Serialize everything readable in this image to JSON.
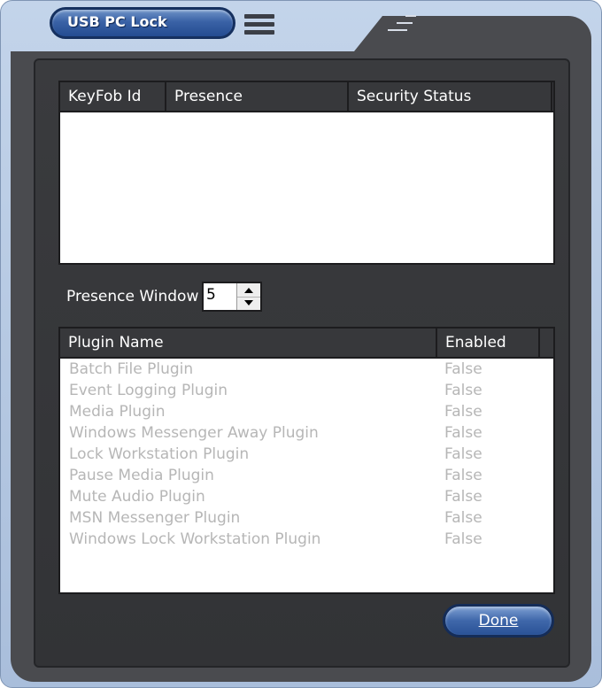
{
  "window": {
    "title": "USB PC Lock"
  },
  "keyfob_table": {
    "columns": [
      "KeyFob Id",
      "Presence",
      "Security Status"
    ],
    "rows": []
  },
  "presence": {
    "label": "Presence Window",
    "value": "5"
  },
  "plugin_table": {
    "columns": [
      "Plugin Name",
      "Enabled"
    ],
    "rows": [
      {
        "name": "Batch File Plugin",
        "enabled": "False"
      },
      {
        "name": "Event Logging Plugin",
        "enabled": "False"
      },
      {
        "name": "Media Plugin",
        "enabled": "False"
      },
      {
        "name": "Windows Messenger Away Plugin",
        "enabled": "False"
      },
      {
        "name": "Lock Workstation Plugin",
        "enabled": "False"
      },
      {
        "name": "Pause Media Plugin",
        "enabled": "False"
      },
      {
        "name": "Mute Audio Plugin",
        "enabled": "False"
      },
      {
        "name": "MSN Messenger Plugin",
        "enabled": "False"
      },
      {
        "name": "Windows Lock Workstation Plugin",
        "enabled": "False"
      }
    ]
  },
  "footer": {
    "done_label": "Done"
  },
  "icons": {
    "menu": "hamburger-menu-icon",
    "grip": "grip-lines-icon",
    "spin_up": "triangle-up-icon",
    "spin_down": "triangle-down-icon"
  },
  "colors": {
    "accent_blue": "#3a62a6",
    "dark_panel": "#4a4b4f",
    "disabled_text": "#b6b6b6"
  }
}
